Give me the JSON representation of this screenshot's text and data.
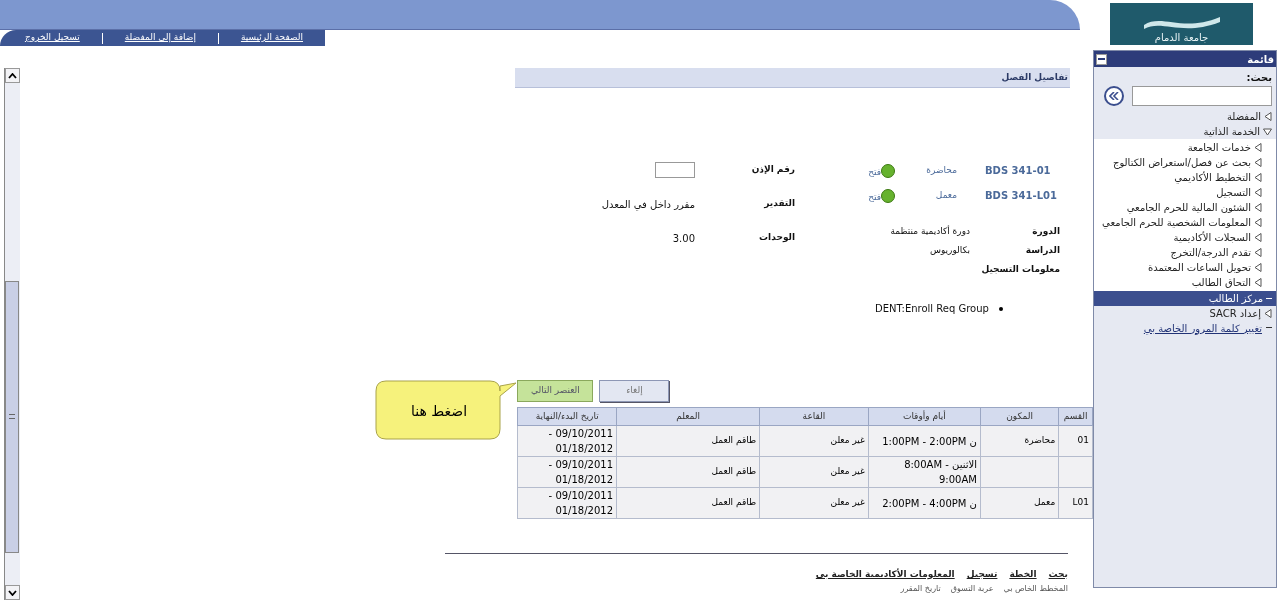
{
  "top_nav": {
    "links": [
      "الصفحة الرئيسية",
      "إضافة إلى المفضلة",
      "تسجيل الخروج"
    ]
  },
  "logo": {
    "text": "جامعة الدمام"
  },
  "sidebar": {
    "title": "قائمة",
    "search_label": "بحث:",
    "items": [
      {
        "label": "المفضلة",
        "kind": "folder",
        "expanded": false,
        "selected": false
      },
      {
        "label": "الخدمة الذاتية",
        "kind": "folder",
        "expanded": true,
        "selected": false,
        "children": [
          {
            "label": "خدمات الجامعة",
            "kind": "folder",
            "expanded": false,
            "selected": false
          },
          {
            "label": "بحث عن فصل/استعراض الكتالوج",
            "kind": "folder",
            "expanded": false,
            "selected": false
          },
          {
            "label": "التخطيط الأكاديمي",
            "kind": "folder",
            "expanded": false,
            "selected": false
          },
          {
            "label": "التسجيل",
            "kind": "folder",
            "expanded": false,
            "selected": false
          },
          {
            "label": "الشئون المالية للحرم الجامعي",
            "kind": "folder",
            "expanded": false,
            "selected": false
          },
          {
            "label": "المعلومات الشخصية للحرم الجامعي",
            "kind": "folder",
            "expanded": false,
            "selected": false
          },
          {
            "label": "السجلات الأكاديمية",
            "kind": "folder",
            "expanded": false,
            "selected": false
          },
          {
            "label": "تقدم الدرجة/التخرج",
            "kind": "folder",
            "expanded": false,
            "selected": false
          },
          {
            "label": "تحويل الساعات المعتمدة",
            "kind": "folder",
            "expanded": false,
            "selected": false
          },
          {
            "label": "التحاق الطالب",
            "kind": "folder",
            "expanded": false,
            "selected": false
          }
        ]
      },
      {
        "label": "مركز الطالب",
        "kind": "page",
        "selected": true
      },
      {
        "label": "إعداد SACR",
        "kind": "folder",
        "expanded": false,
        "selected": false
      },
      {
        "label": "تغيير كلمة المرور الخاصة بي",
        "kind": "link",
        "selected": false
      }
    ]
  },
  "section_title": "تفاصيل الفصل",
  "classes": [
    {
      "code": "BDS 341-01",
      "component": "محاضرة",
      "status": "فتح",
      "color": "#66b22e"
    },
    {
      "code": "BDS 341-L01",
      "component": "معمل",
      "status": "فتح",
      "color": "#66b22e"
    }
  ],
  "details_left": [
    {
      "label": "رقم الإذن",
      "kind": "input"
    },
    {
      "label": "التقدير",
      "kind": "text",
      "value": "مقرر داخل في المعدل"
    },
    {
      "label": "الوحدات",
      "kind": "text",
      "value": "3.00"
    }
  ],
  "details_right": [
    {
      "label": "الدورة",
      "value": "دورة أكاديمية منتظمة"
    },
    {
      "label": "الدراسة",
      "value": "بكالوريوس"
    },
    {
      "label": "معلومات التسجيل"
    }
  ],
  "requirements": [
    "DENT:Enroll Req Group"
  ],
  "callout": "اضغط هنا",
  "buttons": [
    {
      "label": "إلغاء",
      "kind": "secondary"
    },
    {
      "label": "العنصر التالي",
      "kind": "primary"
    }
  ],
  "table": {
    "columns": [
      "القسم",
      "المكون",
      "أيام وأوقات",
      "القاعة",
      "المعلم",
      "تاريخ البدء/النهاية"
    ],
    "rows": [
      [
        "01",
        "محاضرة",
        "ن 1:00PM - 2:00PM",
        "غير معلن",
        "طاقم العمل",
        "09/10/2011 - 01/18/2012"
      ],
      [
        "",
        "",
        "الاثنين 8:00AM - 9:00AM",
        "غير معلن",
        "طاقم العمل",
        "09/10/2011 - 01/18/2012"
      ],
      [
        "L01",
        "معمل",
        "ن 2:00PM - 4:00PM",
        "غير معلن",
        "طاقم العمل",
        "09/10/2011 - 01/18/2012"
      ]
    ]
  },
  "footer_links": [
    "بحث",
    "الخطة",
    "تسجيل",
    "المعلومات الأكاديمية الخاصة بي"
  ],
  "footer_tabs": [
    "المخطط الخاص بي",
    "عربة التسوق",
    "تاريخ المقرر"
  ]
}
